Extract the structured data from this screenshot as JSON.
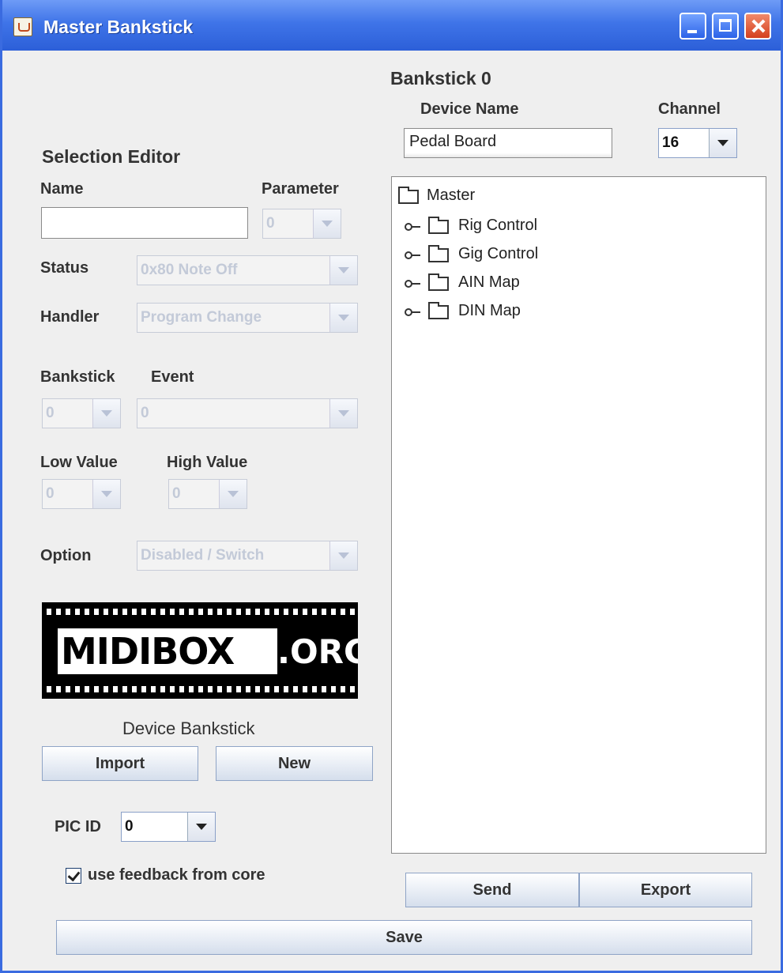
{
  "window": {
    "title": "Master Bankstick",
    "controls": [
      "minimize",
      "maximize",
      "close"
    ]
  },
  "selection_editor": {
    "heading": "Selection Editor",
    "name_label": "Name",
    "name_value": "",
    "parameter_label": "Parameter",
    "parameter_value": "0",
    "status_label": "Status",
    "status_value": "0x80 Note Off",
    "handler_label": "Handler",
    "handler_value": "Program Change",
    "bankstick_label": "Bankstick",
    "bankstick_value": "0",
    "event_label": "Event",
    "event_value": "0",
    "low_value_label": "Low Value",
    "low_value_value": "0",
    "high_value_label": "High Value",
    "high_value_value": "0",
    "option_label": "Option",
    "option_value": "Disabled / Switch"
  },
  "logo": {
    "text_main": "MIDIBOX",
    "text_suffix": ".ORG"
  },
  "device_bankstick": {
    "label": "Device Bankstick",
    "import_label": "Import",
    "new_label": "New"
  },
  "pic_id": {
    "label": "PIC ID",
    "value": "0"
  },
  "feedback": {
    "label": "use feedback from core",
    "checked": true
  },
  "bankstick": {
    "heading": "Bankstick 0",
    "device_name_label": "Device Name",
    "device_name_value": "Pedal Board",
    "channel_label": "Channel",
    "channel_value": "16"
  },
  "tree": {
    "root": "Master",
    "children": [
      "Rig Control",
      "Gig Control",
      "AIN Map",
      "DIN Map"
    ]
  },
  "actions": {
    "send_label": "Send",
    "export_label": "Export",
    "save_label": "Save"
  }
}
